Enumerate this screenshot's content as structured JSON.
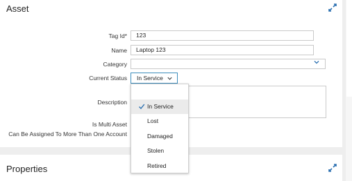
{
  "asset": {
    "title": "Asset",
    "fields": {
      "tag_id": {
        "label": "Tag Id*",
        "value": "123"
      },
      "name": {
        "label": "Name",
        "value": "Laptop 123"
      },
      "category": {
        "label": "Category",
        "value": ""
      },
      "current_status": {
        "label": "Current Status",
        "value": "In Service"
      },
      "description": {
        "label": "Description",
        "value": ""
      },
      "is_multi_asset": {
        "label": "Is Multi Asset"
      },
      "assign_multi_account": {
        "label": "Can Be Assigned To More Than One Account"
      }
    },
    "status_options": [
      "In Service",
      "Lost",
      "Damaged",
      "Stolen",
      "Retired"
    ],
    "selected_status_index": 0
  },
  "properties": {
    "title": "Properties"
  },
  "icons": {
    "collapse": "collapse-arrows-icon",
    "check": "check-icon",
    "chevron": "chevron-down-icon"
  },
  "colors": {
    "accent": "#2a6fb0",
    "focus_border": "#3c8dbc"
  }
}
